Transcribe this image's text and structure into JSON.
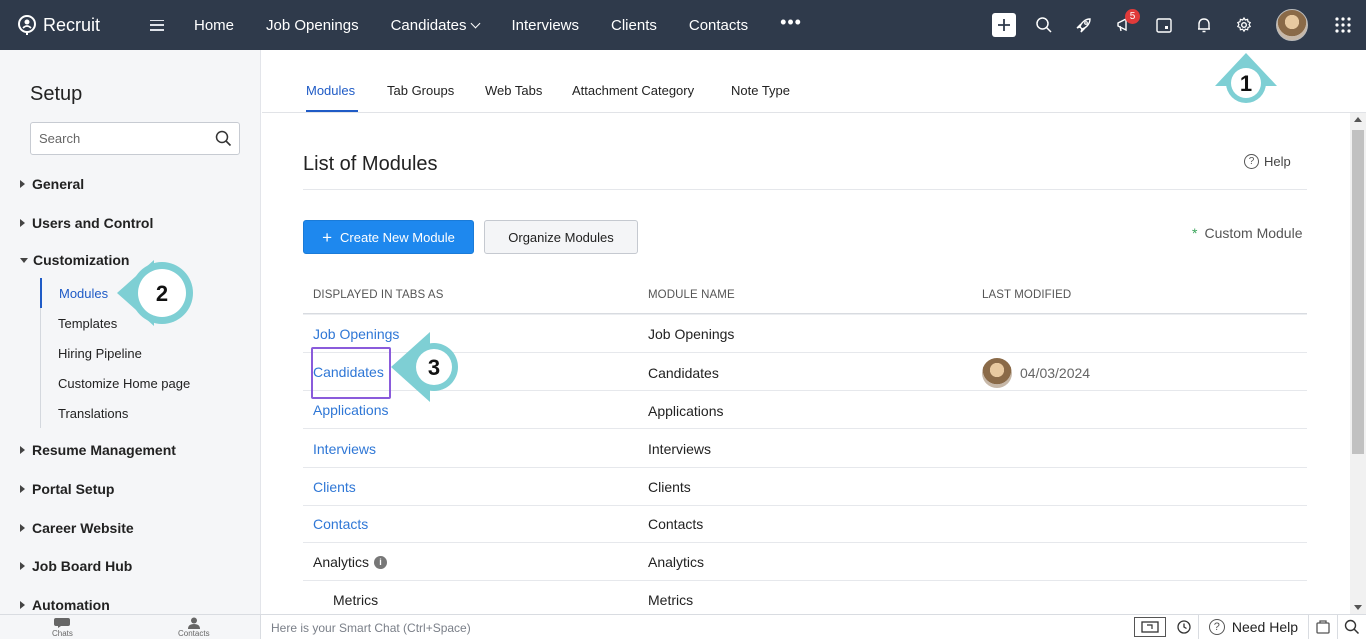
{
  "topnav": {
    "brand": "Recruit",
    "links": [
      {
        "label": "Home"
      },
      {
        "label": "Job Openings"
      },
      {
        "label": "Candidates",
        "has_dropdown": true
      },
      {
        "label": "Interviews"
      },
      {
        "label": "Clients"
      },
      {
        "label": "Contacts"
      }
    ],
    "more": "•••",
    "notification_count": "5",
    "icons": [
      "plus-icon",
      "search-icon",
      "rocket-icon",
      "announcement-icon",
      "calendar-icon",
      "bell-icon",
      "gear-icon",
      "avatar",
      "apps-grid-icon"
    ]
  },
  "sidebar": {
    "title": "Setup",
    "search_placeholder": "Search",
    "groups": [
      {
        "label": "General"
      },
      {
        "label": "Users and Control"
      },
      {
        "label": "Customization",
        "expanded": true
      },
      {
        "label": "Resume Management"
      },
      {
        "label": "Portal Setup"
      },
      {
        "label": "Career Website"
      },
      {
        "label": "Job Board Hub"
      },
      {
        "label": "Automation"
      }
    ],
    "customization_items": [
      {
        "label": "Modules",
        "active": true
      },
      {
        "label": "Templates"
      },
      {
        "label": "Hiring Pipeline"
      },
      {
        "label": "Customize Home page"
      },
      {
        "label": "Translations"
      }
    ]
  },
  "main": {
    "tabs": [
      {
        "label": "Modules",
        "active": true
      },
      {
        "label": "Tab Groups"
      },
      {
        "label": "Web Tabs"
      },
      {
        "label": "Attachment Category"
      },
      {
        "label": "Note Type"
      }
    ],
    "title": "List of Modules",
    "help": "Help",
    "create_button": "Create New Module",
    "organize_button": "Organize Modules",
    "custom_module_legend": "Custom Module",
    "columns": [
      "DISPLAYED IN TABS AS",
      "MODULE NAME",
      "LAST MODIFIED"
    ],
    "rows": [
      {
        "tab": "Job Openings",
        "name": "Job Openings",
        "modified": ""
      },
      {
        "tab": "Candidates",
        "name": "Candidates",
        "modified": "04/03/2024"
      },
      {
        "tab": "Applications",
        "name": "Applications",
        "modified": ""
      },
      {
        "tab": "Interviews",
        "name": "Interviews",
        "modified": ""
      },
      {
        "tab": "Clients",
        "name": "Clients",
        "modified": ""
      },
      {
        "tab": "Contacts",
        "name": "Contacts",
        "modified": ""
      },
      {
        "tab": "Analytics",
        "name": "Analytics",
        "modified": ""
      },
      {
        "tab": "Metrics",
        "name": "Metrics",
        "modified": ""
      }
    ]
  },
  "bottombar": {
    "chats": "Chats",
    "contacts": "Contacts",
    "smart_chat_placeholder": "Here is your Smart Chat (Ctrl+Space)",
    "need_help": "Need Help"
  },
  "annotations": [
    "1",
    "2",
    "3"
  ],
  "colors": {
    "topnav_bg": "#2f3a4b",
    "accent": "#1f5bc6",
    "link": "#2f77d6",
    "primary_button": "#1e88ee",
    "annotation_arrow": "#7ecfd4",
    "highlight_box": "#8a5bdb"
  }
}
